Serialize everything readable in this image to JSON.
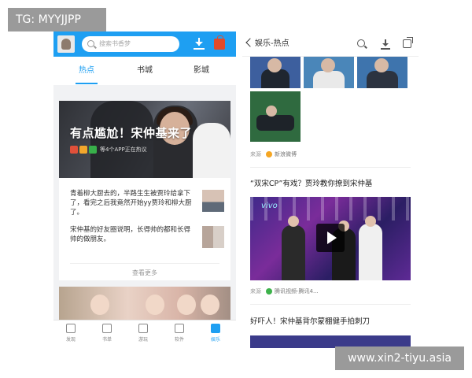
{
  "watermarks": {
    "tg": "TG: MYYJJPP",
    "url": "www.xin2-tiyu.asia"
  },
  "left_app": {
    "search_placeholder": "搜索书香梦",
    "tabs": [
      {
        "label": "热点",
        "active": true
      },
      {
        "label": "书城",
        "active": false
      },
      {
        "label": "影城",
        "active": false
      }
    ],
    "hero": {
      "title": "有点尴尬！宋仲基来了",
      "meta": "等4个APP正在热议"
    },
    "items": [
      {
        "text": "青着柳大厨去的，半路生生被贾玲给拿下了，看完之后我竟然开始yy贾玲和柳大厨了。"
      },
      {
        "text": "宋仲基的好友圈说明，长得帅的都和长得帅的做朋友。"
      }
    ],
    "more_label": "查看更多",
    "bottom_nav": [
      {
        "label": "发现",
        "icon": "home-icon",
        "active": false
      },
      {
        "label": "书单",
        "icon": "bookshelf-icon",
        "active": false
      },
      {
        "label": "游玩",
        "icon": "image-icon",
        "active": false
      },
      {
        "label": "软件",
        "icon": "grid-icon",
        "active": false
      },
      {
        "label": "娱乐",
        "icon": "star-icon",
        "active": true
      }
    ],
    "colors": {
      "accent": "#1e9ff2",
      "cart": "#e24a2a"
    }
  },
  "right_app": {
    "title": "娱乐-热点",
    "source1": {
      "label": "来源",
      "name": "新浪微博"
    },
    "headline1": "“双宋CP”有戏？贾玲教你撩到宋仲基",
    "video_brand": "vivo",
    "source2": {
      "label": "来源",
      "name": "腾讯视频-腾讯4..."
    },
    "headline2": "好吓人！宋仲基背尔蒙棚健手拍刺刀"
  }
}
